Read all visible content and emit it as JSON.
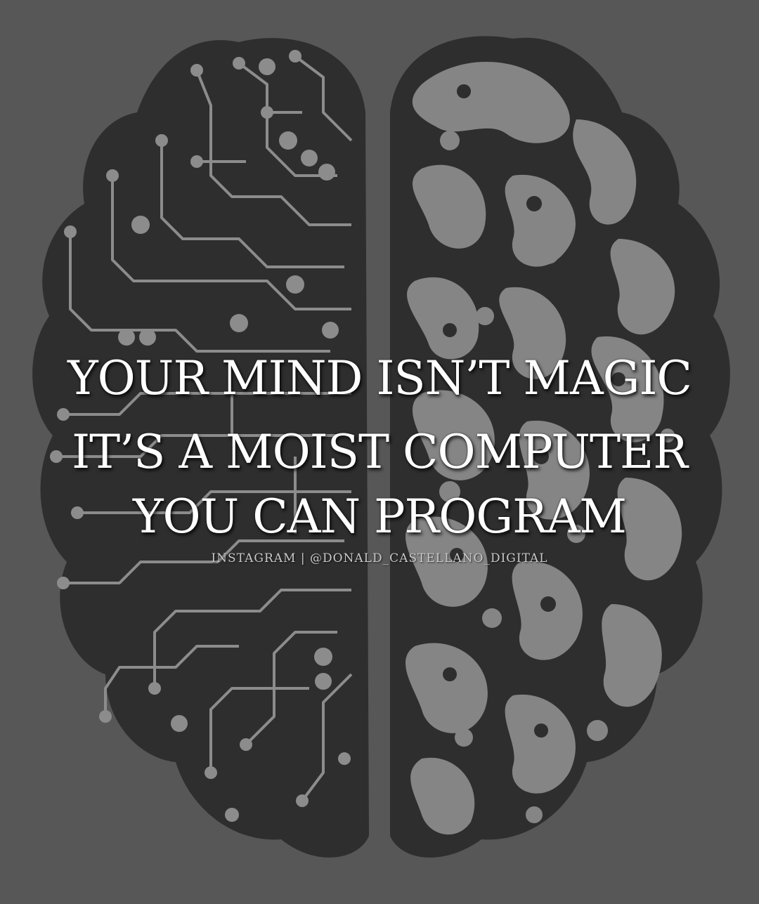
{
  "headline": {
    "line1": "YOUR MIND ISN’T MAGIC",
    "line2": "IT’S A MOIST COMPUTER",
    "line3": "YOU CAN PROGRAM"
  },
  "credit": "INSTAGRAM | @DONALD_CASTELLANO_DIGITAL",
  "colors": {
    "background": "#575757",
    "brain_dark": "#2e2e2e",
    "circuit_trace": "#8c8c8c",
    "organic_light": "#858585",
    "text": "#ffffff"
  },
  "illustration": {
    "left_half": "circuit-board-hemisphere",
    "right_half": "organic-swirl-hemisphere"
  }
}
